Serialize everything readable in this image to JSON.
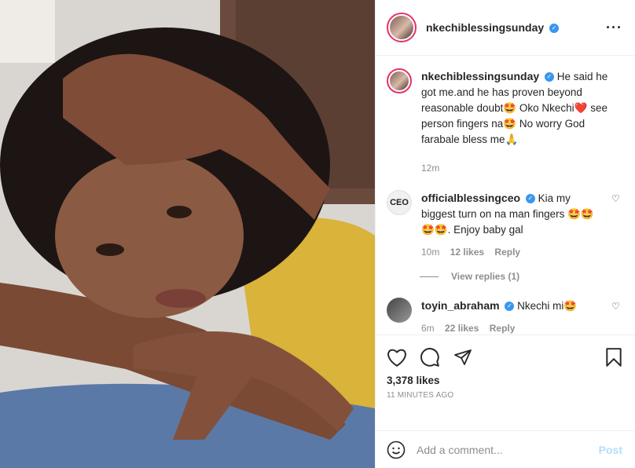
{
  "header": {
    "username": "nkechiblessingsunday"
  },
  "caption": {
    "username": "nkechiblessingsunday",
    "text": "He said he got me.and he has proven beyond reasonable doubt🤩 Oko Nkechi❤️ see person fingers na🤩 No worry God farabale bless me🙏",
    "time": "12m"
  },
  "comments": [
    {
      "avatar_text": "CEO",
      "username": "officialblessingceo",
      "text": "Kia my biggest turn on na man fingers 🤩🤩🤩🤩. Enjoy baby gal",
      "time": "10m",
      "likes": "12 likes",
      "reply": "Reply",
      "view_replies": "View replies (1)"
    },
    {
      "username": "toyin_abraham",
      "text": "Nkechi mi🤩",
      "time": "6m",
      "likes": "22 likes",
      "reply": "Reply"
    }
  ],
  "post_actions": {
    "likes": "3,378 likes",
    "timestamp": "11 MINUTES AGO"
  },
  "add_comment": {
    "placeholder": "Add a comment...",
    "post_label": "Post"
  },
  "icons": {
    "more": "more-icon",
    "like": "heart-icon",
    "comment": "comment-icon",
    "share": "share-icon",
    "save": "bookmark-icon",
    "emoji": "emoji-icon"
  },
  "colors": {
    "accent": "#3897f0",
    "post_disabled": "#b2dffc",
    "muted": "#8e8e8e"
  }
}
